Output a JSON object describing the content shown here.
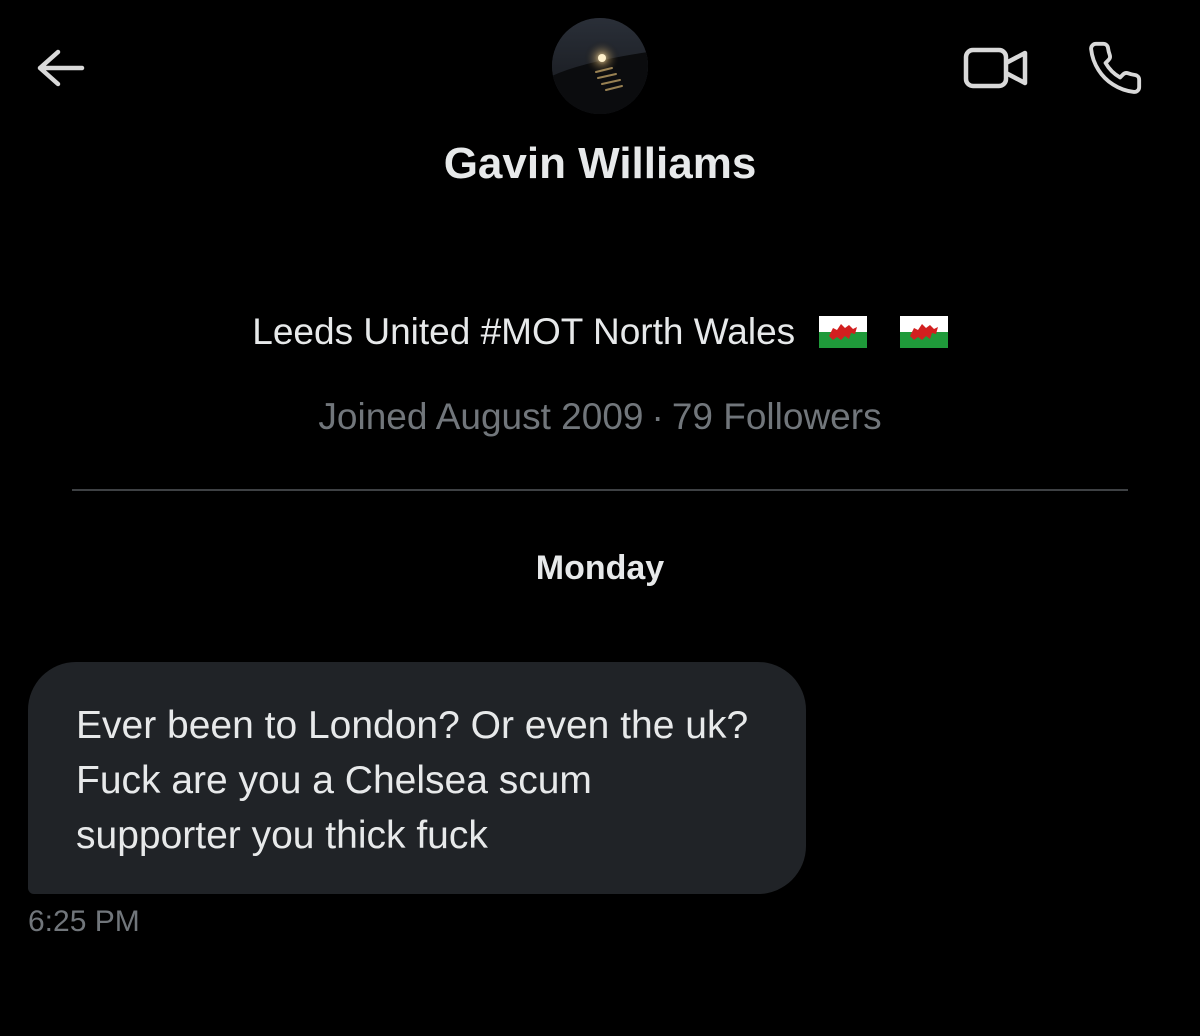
{
  "header": {
    "back_icon": "arrow-left-icon",
    "video_icon": "video-camera-icon",
    "call_icon": "phone-icon"
  },
  "profile": {
    "name": "Gavin Williams",
    "bio": "Leeds United #MOT North Wales",
    "bio_emoji": [
      "wales-flag",
      "wales-flag"
    ],
    "joined": "Joined August 2009",
    "separator": "·",
    "followers": "79 Followers"
  },
  "conversation": {
    "day_label": "Monday",
    "messages": [
      {
        "text": "Ever been to London? Or even the uk? Fuck are you a Chelsea scum supporter you thick fuck",
        "time": "6:25 PM"
      }
    ]
  },
  "colors": {
    "background": "#000000",
    "text_primary": "#e7e9ea",
    "text_secondary": "#71767b",
    "bubble": "#202327",
    "divider": "#3e4144",
    "icon": "#d9d9d9",
    "flag_red": "#d21f1f",
    "flag_white": "#ffffff",
    "flag_green": "#1f9a3a"
  }
}
